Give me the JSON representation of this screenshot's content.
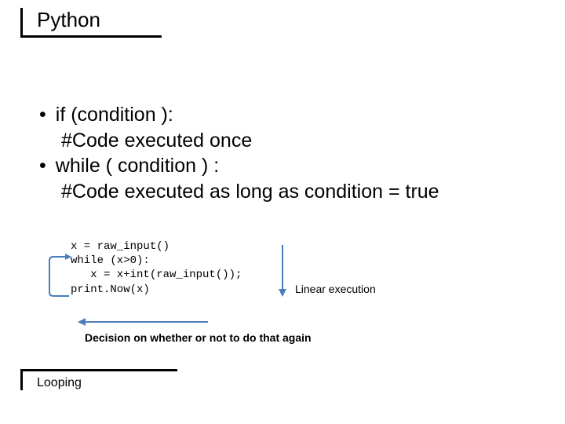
{
  "title": "Python",
  "bullets": {
    "b1": "if (condition ):",
    "b1a": "#Code executed once",
    "b2": "while ( condition ) :",
    "b2a": "#Code executed as long as condition = true"
  },
  "code": {
    "l1": "x = raw_input()",
    "l2": "while (x>0):",
    "l3": "   x = x+int(raw_input());",
    "l4": "print.Now(x)"
  },
  "labels": {
    "linear": "Linear execution",
    "decision": "Decision on whether or not to do that again",
    "footer": "Looping"
  }
}
